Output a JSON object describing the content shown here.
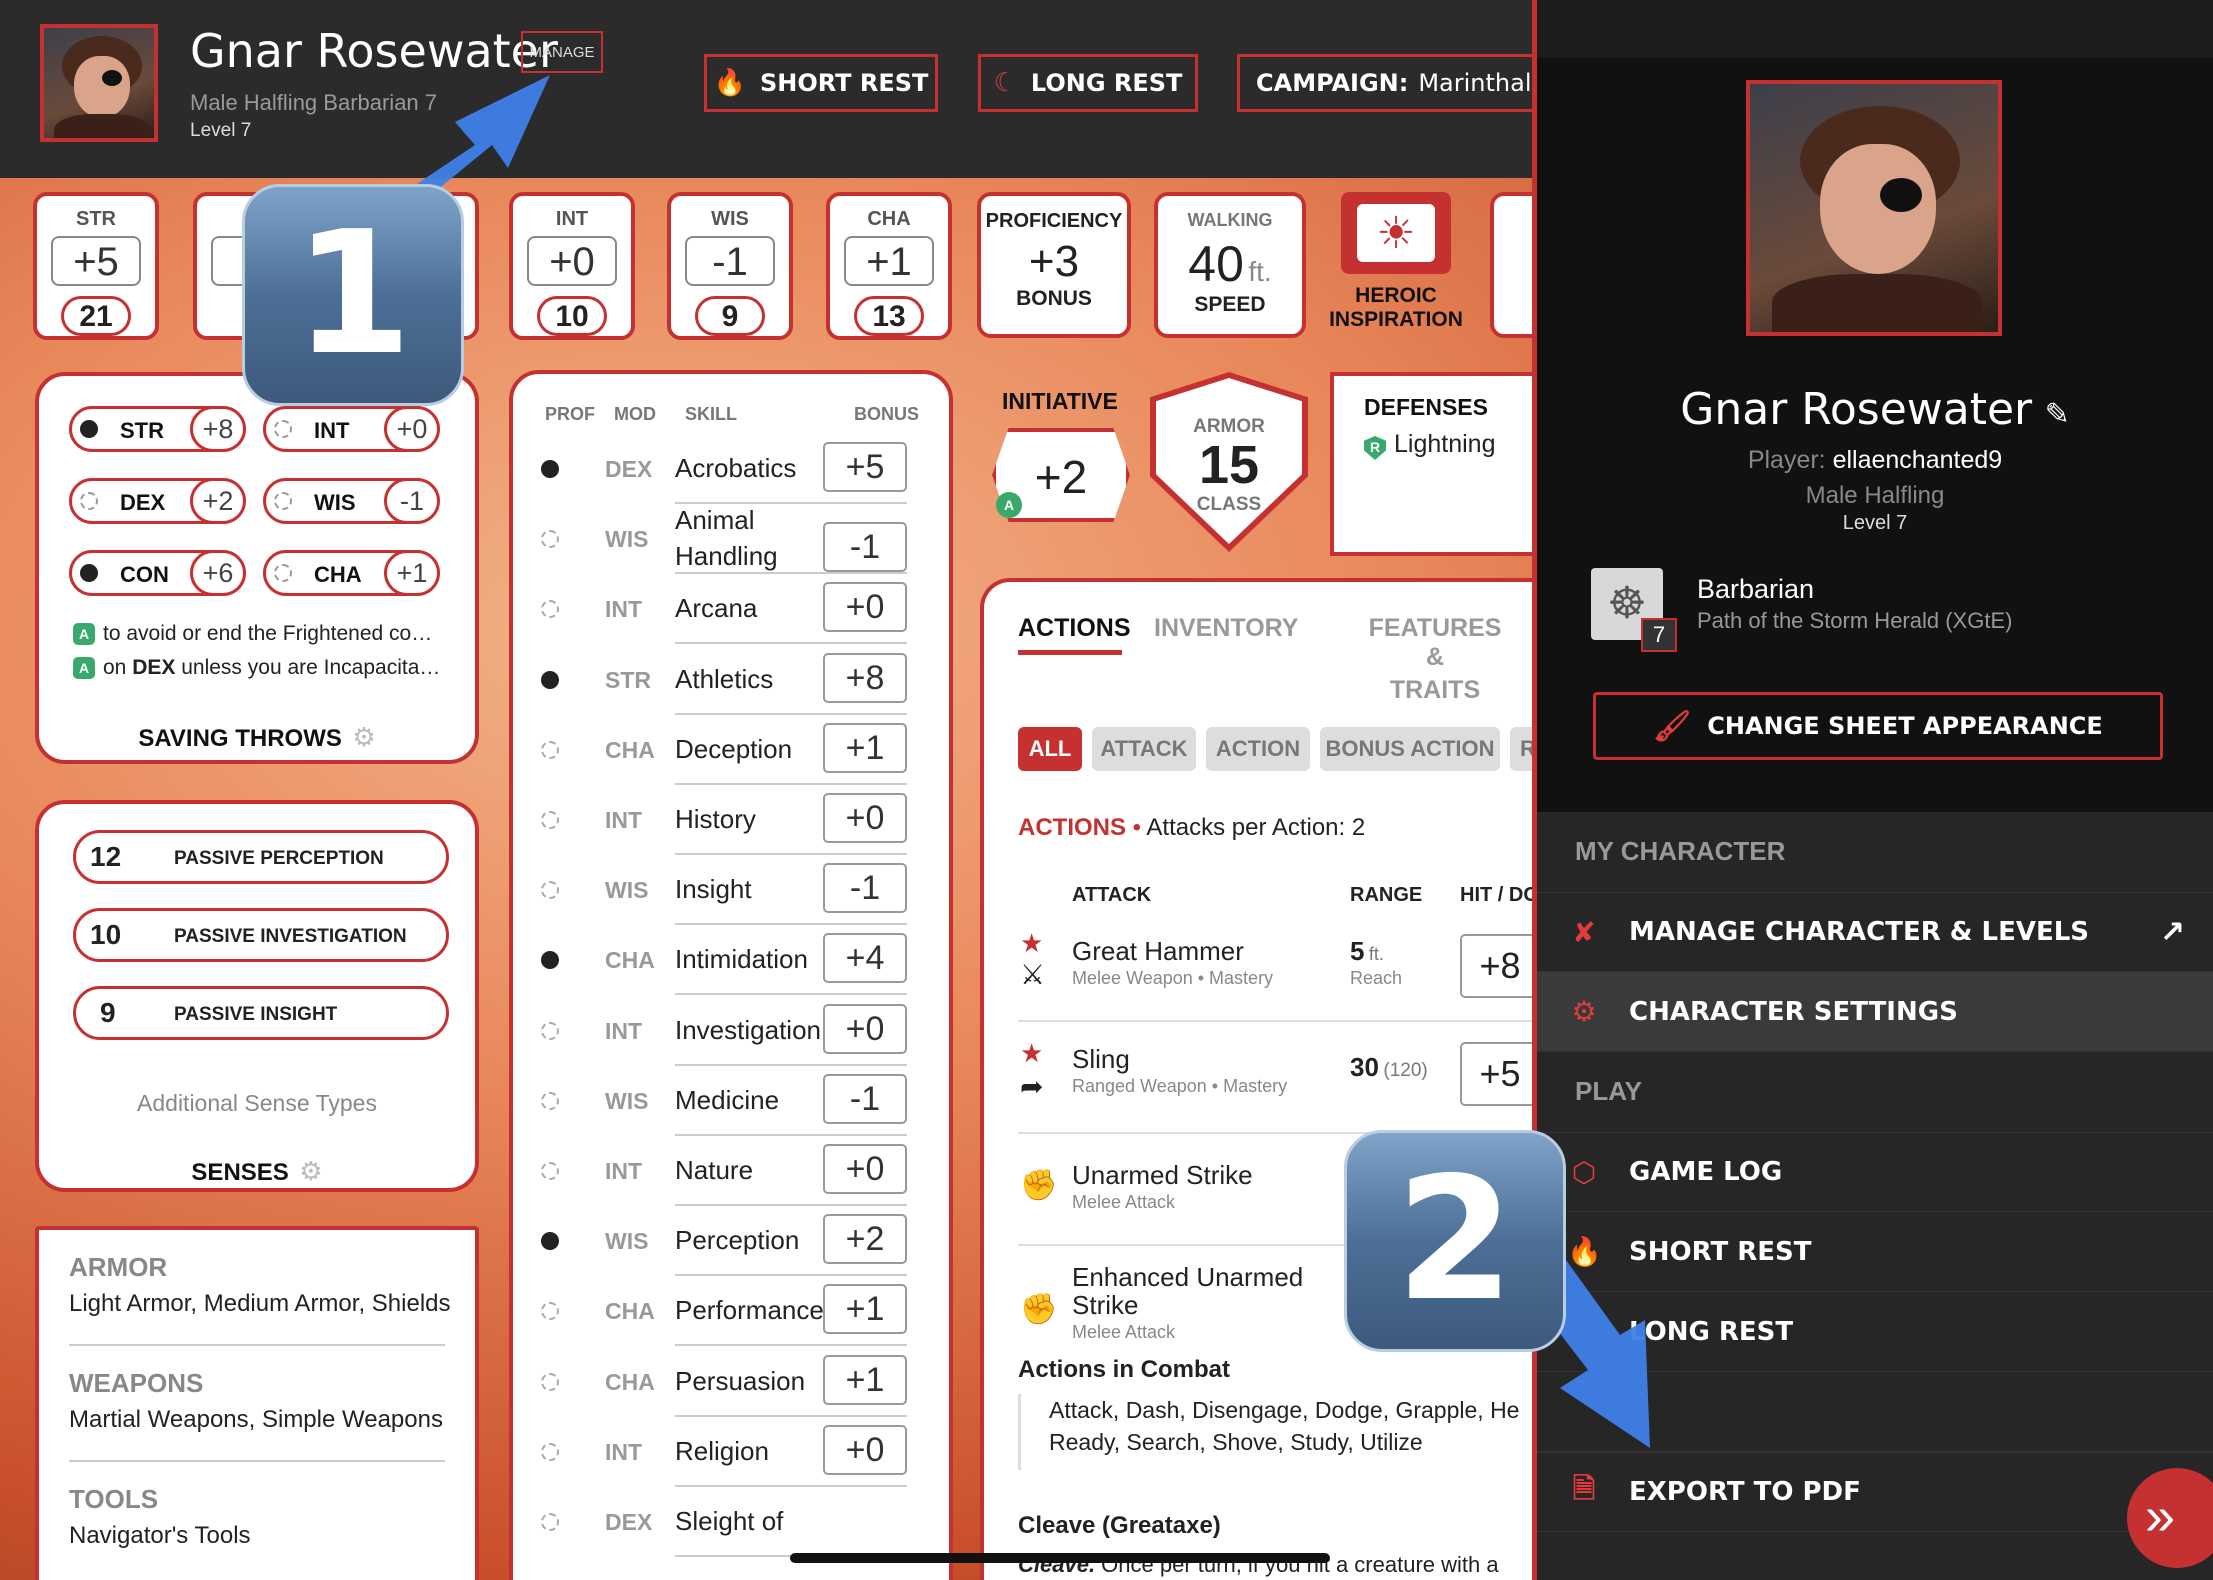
{
  "header": {
    "name": "Gnar Rosewater",
    "subtitle": "Male  Halfling  Barbarian 7",
    "level": "Level 7",
    "manage_label": "MANAGE",
    "short_rest": "SHORT REST",
    "long_rest": "LONG REST",
    "campaign_label": "CAMPAIGN:",
    "campaign_value": "Marinthalis: Th"
  },
  "abilities": [
    {
      "label": "STR",
      "mod": "+5",
      "score": "21"
    },
    {
      "label": "",
      "mod": "-",
      "score": ""
    },
    {
      "label": "",
      "mod": "",
      "score": ""
    },
    {
      "label": "INT",
      "mod": "+0",
      "score": "10"
    },
    {
      "label": "WIS",
      "mod": "-1",
      "score": "9"
    },
    {
      "label": "CHA",
      "mod": "+1",
      "score": "13"
    }
  ],
  "proficiency": {
    "top": "PROFICIENCY",
    "value": "+3",
    "bottom": "BONUS"
  },
  "speed": {
    "top": "WALKING",
    "value": "40",
    "unit": "ft.",
    "bottom": "SPEED"
  },
  "inspiration": {
    "label1": "HEROIC",
    "label2": "INSPIRATION"
  },
  "saving_throws": {
    "rows": [
      {
        "abbr": "STR",
        "val": "+8",
        "prof": true
      },
      {
        "abbr": "INT",
        "val": "+0",
        "prof": false
      },
      {
        "abbr": "DEX",
        "val": "+2",
        "prof": false
      },
      {
        "abbr": "WIS",
        "val": "-1",
        "prof": false
      },
      {
        "abbr": "CON",
        "val": "+6",
        "prof": true
      },
      {
        "abbr": "CHA",
        "val": "+1",
        "prof": false
      }
    ],
    "note1": "to avoid or end the Frightened co…",
    "note2_pre": "on ",
    "note2_bold": "DEX",
    "note2_post": " unless you are Incapacita…",
    "adv_letter": "A",
    "title": "SAVING THROWS"
  },
  "senses": {
    "rows": [
      {
        "value": "12",
        "label": "PASSIVE PERCEPTION"
      },
      {
        "value": "10",
        "label": "PASSIVE INVESTIGATION"
      },
      {
        "value": "9",
        "label": "PASSIVE INSIGHT"
      }
    ],
    "additional": "Additional Sense Types",
    "title": "SENSES"
  },
  "proficiencies": {
    "armor_title": "ARMOR",
    "armor": "Light Armor, Medium Armor, Shields",
    "weapons_title": "WEAPONS",
    "weapons": "Martial Weapons, Simple Weapons",
    "tools_title": "TOOLS",
    "tools": "Navigator's Tools"
  },
  "skills": {
    "headers": {
      "prof": "PROF",
      "mod": "MOD",
      "skill": "SKILL",
      "bonus": "BONUS"
    },
    "rows": [
      {
        "prof": true,
        "mod": "DEX",
        "name": "Acrobatics",
        "bonus": "+5"
      },
      {
        "prof": false,
        "mod": "WIS",
        "name": "Animal Handling",
        "bonus": "-1"
      },
      {
        "prof": false,
        "mod": "INT",
        "name": "Arcana",
        "bonus": "+0"
      },
      {
        "prof": true,
        "mod": "STR",
        "name": "Athletics",
        "bonus": "+8"
      },
      {
        "prof": false,
        "mod": "CHA",
        "name": "Deception",
        "bonus": "+1"
      },
      {
        "prof": false,
        "mod": "INT",
        "name": "History",
        "bonus": "+0"
      },
      {
        "prof": false,
        "mod": "WIS",
        "name": "Insight",
        "bonus": "-1"
      },
      {
        "prof": true,
        "mod": "CHA",
        "name": "Intimidation",
        "bonus": "+4"
      },
      {
        "prof": false,
        "mod": "INT",
        "name": "Investigation",
        "bonus": "+0"
      },
      {
        "prof": false,
        "mod": "WIS",
        "name": "Medicine",
        "bonus": "-1"
      },
      {
        "prof": false,
        "mod": "INT",
        "name": "Nature",
        "bonus": "+0"
      },
      {
        "prof": true,
        "mod": "WIS",
        "name": "Perception",
        "bonus": "+2"
      },
      {
        "prof": false,
        "mod": "CHA",
        "name": "Performance",
        "bonus": "+1"
      },
      {
        "prof": false,
        "mod": "CHA",
        "name": "Persuasion",
        "bonus": "+1"
      },
      {
        "prof": false,
        "mod": "INT",
        "name": "Religion",
        "bonus": "+0"
      },
      {
        "prof": false,
        "mod": "DEX",
        "name": "Sleight of",
        "bonus": ""
      }
    ]
  },
  "initiative": {
    "label": "INITIATIVE",
    "value": "+2"
  },
  "armor_class": {
    "top": "ARMOR",
    "value": "15",
    "bottom": "CLASS"
  },
  "defenses": {
    "title": "DEFENSES",
    "value": "Lightning"
  },
  "actions_panel": {
    "tabs": [
      "ACTIONS",
      "INVENTORY",
      "FEATURES &",
      "TRAITS"
    ],
    "filters": [
      "ALL",
      "ATTACK",
      "ACTION",
      "BONUS ACTION",
      "RE"
    ],
    "heading": "ACTIONS",
    "attacks_per": "Attacks per Action: 2",
    "col_attack": "ATTACK",
    "col_range": "RANGE",
    "col_hit": "HIT / DC",
    "attacks": [
      {
        "name": "Great Hammer",
        "sub": "Melee Weapon • Mastery",
        "range": "5",
        "range_unit": "ft.",
        "range_sub": "Reach",
        "hit": "+8"
      },
      {
        "name": "Sling",
        "sub": "Ranged Weapon • Mastery",
        "range": "30",
        "range_unit": "(120)",
        "range_sub": "",
        "hit": "+5"
      },
      {
        "name": "Unarmed Strike",
        "sub": "Melee Attack",
        "range": "",
        "range_unit": "",
        "range_sub": "",
        "hit": ""
      },
      {
        "name": "Enhanced Unarmed",
        "name2": "Strike",
        "sub": "Melee Attack",
        "range": "",
        "range_unit": "",
        "range_sub": "",
        "hit": ""
      }
    ],
    "combat_title": "Actions in Combat",
    "combat_line1": "Attack, Dash, Disengage, Dodge, Grapple, He",
    "combat_line2": "Ready, Search, Shove, Study, Utilize",
    "cleave_title": "Cleave (Greataxe)",
    "cleave_text_bold": "Cleave.",
    "cleave_text": " Once per turn, if you hit a creature with a"
  },
  "side_panel": {
    "name": "Gnar Rosewater",
    "player_label": "Player:",
    "player": "ellaenchanted9",
    "race": "Male  Halfling",
    "level": "Level 7",
    "class_name": "Barbarian",
    "subclass": "Path of the Storm Herald (XGtE)",
    "class_level": "7",
    "appearance_btn": "CHANGE SHEET APPEARANCE",
    "sec_character": "MY CHARACTER",
    "manage": "MANAGE CHARACTER & LEVELS",
    "settings": "CHARACTER SETTINGS",
    "sec_play": "PLAY",
    "game_log": "GAME LOG",
    "short_rest": "SHORT REST",
    "long_rest": "LONG REST",
    "export": "EXPORT TO PDF"
  },
  "overlays": {
    "badge1": "1",
    "badge2": "2"
  },
  "colors": {
    "accent": "#c53131",
    "panel_bg": "#111111",
    "topbar": "#2b2b2b",
    "advantage": "#39a86b",
    "annotation_arrow": "#3f7fe8"
  }
}
